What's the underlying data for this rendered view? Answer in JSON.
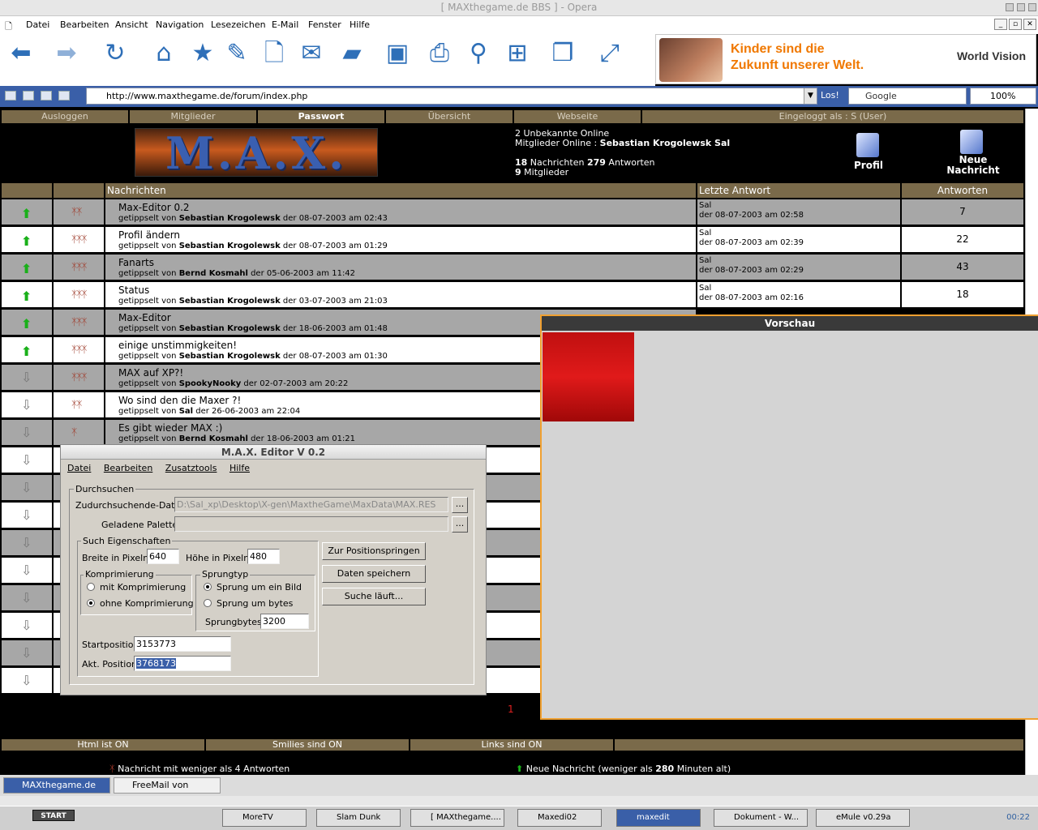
{
  "window": {
    "title": "[ MAXthegame.de BBS ] - Opera"
  },
  "menubar": {
    "items": [
      "Datei",
      "Bearbeiten",
      "Ansicht",
      "Navigation",
      "Lesezeichen",
      "E-Mail",
      "Fenster",
      "Hilfe"
    ]
  },
  "ad": {
    "slogan_line1": "Kinder sind die",
    "slogan_line2": "Zukunft unserer Welt.",
    "brand": "World Vision"
  },
  "address": {
    "url": "http://www.maxthegame.de/forum/index.php",
    "go_label": "Los!",
    "search_engine": "Google",
    "zoom": "100%"
  },
  "forum": {
    "nav": {
      "logout": "Ausloggen",
      "members": "Mitglieder",
      "password": "Passwort",
      "overview": "Übersicht",
      "website": "Webseite",
      "logged_in": "Eingeloggt als : S (User)"
    },
    "logo_text": "M.A.X.",
    "stats": {
      "unknown_online": "2 Unbekannte Online",
      "members_online_label": "Mitglieder Online : ",
      "members_online_names": "Sebastian Krogolewsk Sal",
      "messages_count": "18",
      "messages_label": " Nachrichten ",
      "answers_count": "279",
      "answers_label": " Antworten",
      "members_count": "9",
      "members_label": " Mitglieder"
    },
    "profile_label": "Profil",
    "new_message_line1": "Neue",
    "new_message_line2": "Nachricht",
    "headers": {
      "messages": "Nachrichten",
      "last_reply": "Letzte Antwort",
      "replies": "Antworten"
    },
    "topics": [
      {
        "title": "Max-Editor 0.2",
        "prefix": "getippselt von ",
        "author": "Sebastian Krogolewsk",
        "posted": " der 08-07-2003 am 02:43",
        "last_by": "Sal",
        "last_time": "der 08-07-2003 am 02:58",
        "replies": "7"
      },
      {
        "title": "Profil ändern",
        "prefix": "getippselt von ",
        "author": "Sebastian Krogolewsk",
        "posted": " der 08-07-2003 am 01:29",
        "last_by": "Sal",
        "last_time": "der 08-07-2003 am 02:39",
        "replies": "22"
      },
      {
        "title": "Fanarts",
        "prefix": "getippselt von ",
        "author": "Bernd Kosmahl",
        "posted": " der 05-06-2003 am 11:42",
        "last_by": "Sal",
        "last_time": "der 08-07-2003 am 02:29",
        "replies": "43"
      },
      {
        "title": "Status",
        "prefix": "getippselt von ",
        "author": "Sebastian Krogolewsk",
        "posted": " der 03-07-2003 am 21:03",
        "last_by": "Sal",
        "last_time": "der 08-07-2003 am 02:16",
        "replies": "18"
      },
      {
        "title": "Max-Editor",
        "prefix": "getippselt von ",
        "author": "Sebastian Krogolewsk",
        "posted": " der 18-06-2003 am 01:48"
      },
      {
        "title": "einige unstimmigkeiten!",
        "prefix": "getippselt von ",
        "author": "Sebastian Krogolewsk",
        "posted": " der 08-07-2003 am 01:30"
      },
      {
        "title": "MAX auf XP?!",
        "prefix": "getippselt von ",
        "author": "SpookyNooky",
        "posted": " der 02-07-2003 am 20:22"
      },
      {
        "title": "Wo sind den die Maxer ?!",
        "prefix": "getippselt von ",
        "author": "Sal",
        "posted": " der 26-06-2003 am 22:04"
      },
      {
        "title": "Es gibt wieder MAX :)",
        "prefix": "getippselt von ",
        "author": "Bernd Kosmahl",
        "posted": " der 18-06-2003 am 01:21"
      }
    ],
    "page_number": "1",
    "footer": {
      "html": "Html ist ON",
      "smilies": "Smilies sind ON",
      "links": "Links sind ON"
    },
    "legend": {
      "few_replies": "Nachricht mit weniger als 4 Antworten",
      "new_message_prefix": "Neue Nachricht (weniger als ",
      "new_message_minutes": "280",
      "new_message_suffix": " Minuten alt)"
    }
  },
  "vorschau": {
    "title": "Vorschau"
  },
  "editor": {
    "title": "M.A.X. Editor V 0.2",
    "menu": [
      "Datei",
      "Bearbeiten",
      "Zusatztools",
      "Hilfe"
    ],
    "group_search": "Durchsuchen",
    "file_label": "Zudurchsuchende-Datei:",
    "file_value": "D:\\Sal_xp\\Desktop\\X-gen\\MaxtheGame\\MaxData\\MAX.RES",
    "palette_label": "Geladene Palette:",
    "palette_value": "",
    "browse": "...",
    "group_props": "Such Eigenschaften",
    "width_label": "Breite in Pixeln:",
    "width_value": "640",
    "height_label": "Höhe in Pixeln:",
    "height_value": "480",
    "group_compression": "Komprimierung",
    "with_compression": "mit Komprimierung",
    "without_compression": "ohne Komprimierung",
    "group_jump": "Sprungtyp",
    "jump_image": "Sprung um ein Bild",
    "jump_bytes": "Sprung um bytes",
    "jumpbytes_label": "Sprungbytes:",
    "jumpbytes_value": "3200",
    "btn_goto": "Zur Positionspringen",
    "btn_save": "Daten speichern",
    "btn_search": "Suche läuft...",
    "start_label": "Startposition:",
    "start_value": "3153773",
    "current_label": "Akt. Position:",
    "current_value": "3768173"
  },
  "tabs": [
    "MAXthegame.de BBS",
    "FreeMail von WEB.DE"
  ],
  "taskbar": {
    "start": "START",
    "tasks": [
      "MoreTV",
      "Slam Dunk",
      "[ MAXthegame....",
      "Maxedi02",
      "maxedit",
      "Dokument - W...",
      "eMule v0.29a"
    ],
    "clock": "00:22"
  }
}
